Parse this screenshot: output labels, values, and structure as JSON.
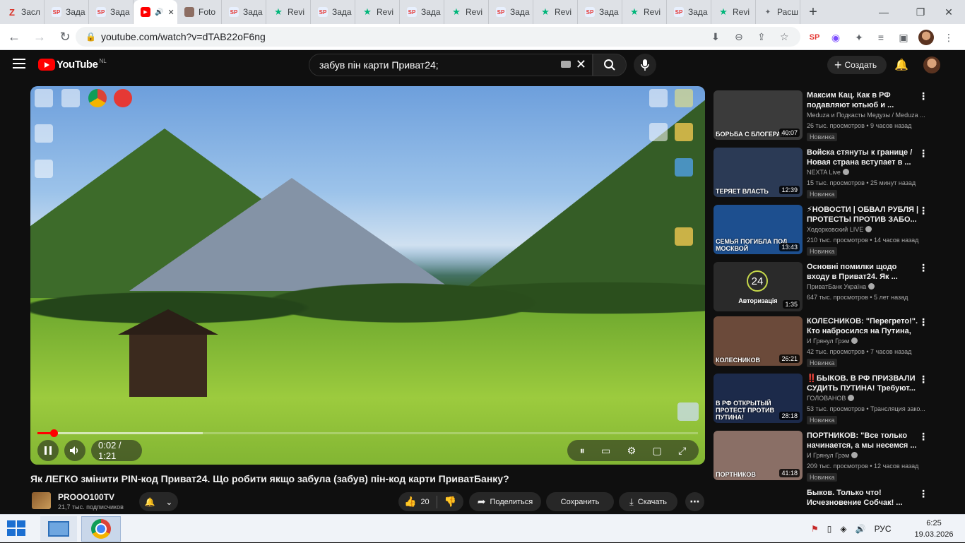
{
  "browser": {
    "tabs": [
      {
        "icon": "zeta-icon",
        "label": "Засл",
        "color": "#d93025"
      },
      {
        "icon": "sp-icon",
        "label": "Зада",
        "color": "#e8f0fe"
      },
      {
        "icon": "sp-icon",
        "label": "Зада",
        "color": "#e8f0fe"
      },
      {
        "icon": "youtube-icon",
        "label": "",
        "color": "#ff0000",
        "active": true
      },
      {
        "icon": "photo-icon",
        "label": "Foto",
        "color": "#8d6e63"
      },
      {
        "icon": "sp-icon",
        "label": "Зада",
        "color": "#e8f0fe"
      },
      {
        "icon": "star-icon",
        "label": "Revi",
        "color": "#00b67a"
      },
      {
        "icon": "sp-icon",
        "label": "Зада",
        "color": "#e8f0fe"
      },
      {
        "icon": "star-icon",
        "label": "Revi",
        "color": "#00b67a"
      },
      {
        "icon": "sp-icon",
        "label": "Зада",
        "color": "#e8f0fe"
      },
      {
        "icon": "star-icon",
        "label": "Revi",
        "color": "#00b67a"
      },
      {
        "icon": "sp-icon",
        "label": "Зада",
        "color": "#e8f0fe"
      },
      {
        "icon": "star-icon",
        "label": "Revi",
        "color": "#00b67a"
      },
      {
        "icon": "sp-icon",
        "label": "Зада",
        "color": "#e8f0fe"
      },
      {
        "icon": "star-icon",
        "label": "Revi",
        "color": "#00b67a"
      },
      {
        "icon": "sp-icon",
        "label": "Зада",
        "color": "#e8f0fe"
      },
      {
        "icon": "star-icon",
        "label": "Revi",
        "color": "#00b67a"
      },
      {
        "icon": "puzzle-icon",
        "label": "Расш",
        "color": "#5f6368"
      }
    ],
    "new_tab": "+",
    "url": "youtube.com/watch?v=dTAB22oF6ng"
  },
  "youtube": {
    "logo_text": "YouTube",
    "country_code": "NL",
    "search_value": "забув пін карти Приват24;",
    "create_label": "Создать"
  },
  "player": {
    "time": "0:02 / 1:21",
    "progress_fraction": 0.025,
    "buffered_fraction": 0.25
  },
  "video": {
    "title": "Як ЛЕГКО змінити PIN-код Приват24. Що робити якщо забула (забув) пін-код карти ПриватБанку?",
    "channel": "PROOO100TV",
    "subscribers": "21,7 тыс. подписчиков",
    "likes": "20",
    "share_label": "Поделиться",
    "save_label": "Сохранить",
    "download_label": "Скачать"
  },
  "recommendations": [
    {
      "title": "Максим Кац. Как в РФ подавляют ютьюб и ...",
      "channel": "Meduza и Подкасты Медузы / Meduza ...",
      "meta": "26 тыс. просмотров • 9 часов назад",
      "badge": "Новинка",
      "duration": "40:07",
      "thumb_text": "БОРЬБА С БЛОГЕРАМИ",
      "thumb_color": "#3b3b3b",
      "verified": false
    },
    {
      "title": "Войска стянуты к границе / Новая страна вступает в ...",
      "channel": "NEXTA Live",
      "meta": "15 тыс. просмотров • 25 минут назад",
      "badge": "Новинка",
      "duration": "12:39",
      "thumb_text": "ТЕРЯЕТ ВЛАСТЬ",
      "thumb_color": "#2b3a55",
      "verified": true
    },
    {
      "title": "⚡НОВОСТИ | ОБВАЛ РУБЛЯ | ПРОТЕСТЫ ПРОТИВ ЗАБО...",
      "channel": "Ходорковский LIVE",
      "meta": "210 тыс. просмотров • 14 часов назад",
      "badge": "Новинка",
      "duration": "13:43",
      "thumb_text": "СЕМЬЯ ПОГИБЛА ПОД МОСКВОЙ",
      "thumb_color": "#1d4f8f",
      "verified": true
    },
    {
      "title": "Основні помилки щодо входу в Приват24. Як ...",
      "channel": "ПриватБанк Україна",
      "meta": "647 тыс. просмотров • 5 лет назад",
      "badge": "",
      "duration": "1:35",
      "thumb_text": "Авторизація",
      "thumb_color": "#2a2a2a",
      "verified": true
    },
    {
      "title": "КОЛЕСНИКОВ: \"Перегрето!\". Кто набросился на Путина, ...",
      "channel": "И Грянул Грэм",
      "meta": "42 тыс. просмотров • 7 часов назад",
      "badge": "Новинка",
      "duration": "26:21",
      "thumb_text": "КОЛЕСНИКОВ",
      "thumb_color": "#6b4a3a",
      "verified": true
    },
    {
      "title": "‼️БЫКОВ. В РФ ПРИЗВАЛИ СУДИТЬ ПУТИНА! Требуют...",
      "channel": "ГОЛОВАНОВ",
      "meta": "53 тыс. просмотров • Трансляция зако...",
      "badge": "Новинка",
      "duration": "28:18",
      "thumb_text": "В РФ ОТКРЫТЫЙ ПРОТЕСТ ПРОТИВ ПУТИНА!",
      "thumb_color": "#1c2a4a",
      "verified": true
    },
    {
      "title": "ПОРТНИКОВ: \"Все только начинается, а мы несемся ...",
      "channel": "И Грянул Грэм",
      "meta": "209 тыс. просмотров • 12 часов назад",
      "badge": "Новинка",
      "duration": "41:18",
      "thumb_text": "ПОРТНИКОВ",
      "thumb_color": "#8a6f66",
      "verified": true
    },
    {
      "title": "Быков. Только что! Исчезновение Собчак! ...",
      "channel": "",
      "meta": "",
      "badge": "",
      "duration": "",
      "thumb_text": "",
      "thumb_color": "#0f0f0f",
      "verified": false
    }
  ],
  "auth_thumb_number": "24",
  "taskbar": {
    "language": "РУС",
    "time": "6:25",
    "date": "19.03.2026"
  }
}
